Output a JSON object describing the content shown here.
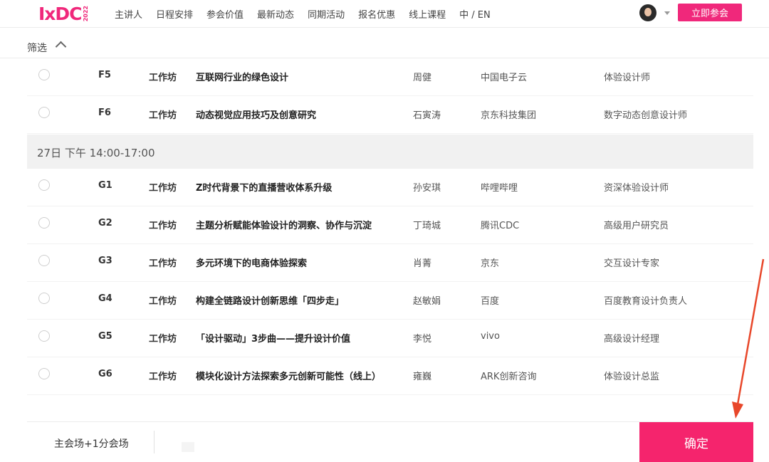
{
  "header": {
    "logo": "IxDC",
    "logo_year": "2022",
    "nav": [
      "主讲人",
      "日程安排",
      "参会价值",
      "最新动态",
      "同期活动",
      "报名优惠",
      "线上课程",
      "中 / EN"
    ],
    "join_label": "立即参会"
  },
  "filter": {
    "label": "筛选"
  },
  "rows_top": [
    {
      "code": "F5",
      "type": "工作坊",
      "title": "互联网行业的绿色设计",
      "speaker": "周健",
      "company": "中国电子云",
      "role": "体验设计师"
    },
    {
      "code": "F6",
      "type": "工作坊",
      "title": "动态视觉应用技巧及创意研究",
      "speaker": "石寅涛",
      "company": "京东科技集团",
      "role": "数字动态创意设计师"
    }
  ],
  "section": {
    "label": "27日  下午 14:00-17:00"
  },
  "rows_bottom": [
    {
      "code": "G1",
      "type": "工作坊",
      "title": "Z时代背景下的直播营收体系升级",
      "speaker": "孙安琪",
      "company": "哔哩哔哩",
      "role": "资深体验设计师"
    },
    {
      "code": "G2",
      "type": "工作坊",
      "title": "主题分析赋能体验设计的洞察、协作与沉淀",
      "speaker": "丁琦城",
      "company": "腾讯CDC",
      "role": "高级用户研究员"
    },
    {
      "code": "G3",
      "type": "工作坊",
      "title": "多元环境下的电商体验探索",
      "speaker": "肖菁",
      "company": "京东",
      "role": "交互设计专家"
    },
    {
      "code": "G4",
      "type": "工作坊",
      "title": "构建全链路设计创新思维「四步走」",
      "speaker": "赵敏娟",
      "company": "百度",
      "role": "百度教育设计负责人"
    },
    {
      "code": "G5",
      "type": "工作坊",
      "title": "「设计驱动」3步曲——提升设计价值",
      "speaker": "李悦",
      "company": "vivo",
      "role": "高级设计经理"
    },
    {
      "code": "G6",
      "type": "工作坊",
      "title": "模块化设计方法探索多元创新可能性（线上）",
      "speaker": "雍巍",
      "company": "ARK创新咨询",
      "role": "体验设计总监"
    }
  ],
  "footer": {
    "selection_label": "主会场+1分会场",
    "confirm_label": "确定"
  },
  "colors": {
    "brand": "#f0287b",
    "confirm": "#f5246d",
    "arrow": "#e8472a"
  }
}
